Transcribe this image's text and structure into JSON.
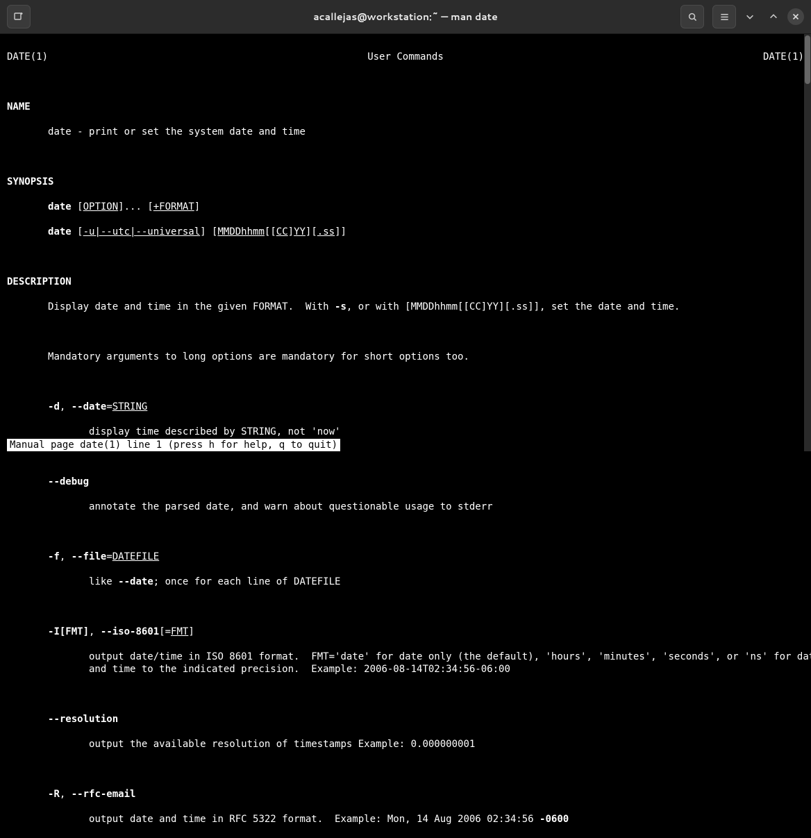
{
  "titlebar": {
    "title": "acallejas@workstation:~ — man date"
  },
  "header": {
    "left": "DATE(1)",
    "center": "User Commands",
    "right": "DATE(1)"
  },
  "sections": {
    "name": {
      "heading": "NAME",
      "text": "date - print or set the system date and time"
    },
    "synopsis": {
      "heading": "SYNOPSIS",
      "l1_cmd": "date",
      "l1_opt_open": " [",
      "l1_opt": "OPTION",
      "l1_opt_close": "]... [",
      "l1_fmt": "+FORMAT",
      "l1_close": "]",
      "l2_cmd": "date",
      "l2_open": " [",
      "l2_utc": "-u|--utc|--universal",
      "l2_mid": "] [",
      "l2_mmdd": "MMDDhhmm",
      "l2_brak1": "[[",
      "l2_cc": "CC",
      "l2_brak2": "]",
      "l2_yy": "YY",
      "l2_brak3": "][",
      "l2_ss": ".ss",
      "l2_close": "]]"
    },
    "description": {
      "heading": "DESCRIPTION",
      "p1a": "Display date and time in the given FORMAT.  With ",
      "p1_flag": "-s",
      "p1b": ", or with [MMDDhhmm[[CC]YY][.ss]], set the date and time.",
      "p2": "Mandatory arguments to long options are mandatory for short options too.",
      "d_short": "-d",
      "sep": ", ",
      "d_long": "--date",
      "eq": "=",
      "d_arg": "STRING",
      "d_desc": "display time described by STRING, not 'now'",
      "debug_flag": "--debug",
      "debug_desc": "annotate the parsed date, and warn about questionable usage to stderr",
      "f_short": "-f",
      "f_long": "--file",
      "f_arg": "DATEFILE",
      "f_desc_a": "like ",
      "f_desc_b": "--date",
      "f_desc_c": "; once for each line of DATEFILE",
      "I_short": "-I[FMT]",
      "I_long": "--iso-8601",
      "I_open": "[=",
      "I_arg": "FMT",
      "I_close": "]",
      "I_desc": "output date/time in ISO 8601 format.  FMT='date' for date only (the default), 'hours', 'minutes', 'seconds', or 'ns' for date\n              and time to the indicated precision.  Example: 2006-08-14T02:34:56-06:00",
      "res_flag": "--resolution",
      "res_desc": "output the available resolution of timestamps Example: 0.000000001",
      "R_short": "-R",
      "R_long": "--rfc-email",
      "R_desc_a": "output date and time in RFC 5322 format.  Example: Mon, 14 Aug 2006 02:34:56 ",
      "R_desc_b": "-0600"
    }
  },
  "status": "Manual page date(1) line 1 (press h for help, q to quit)"
}
